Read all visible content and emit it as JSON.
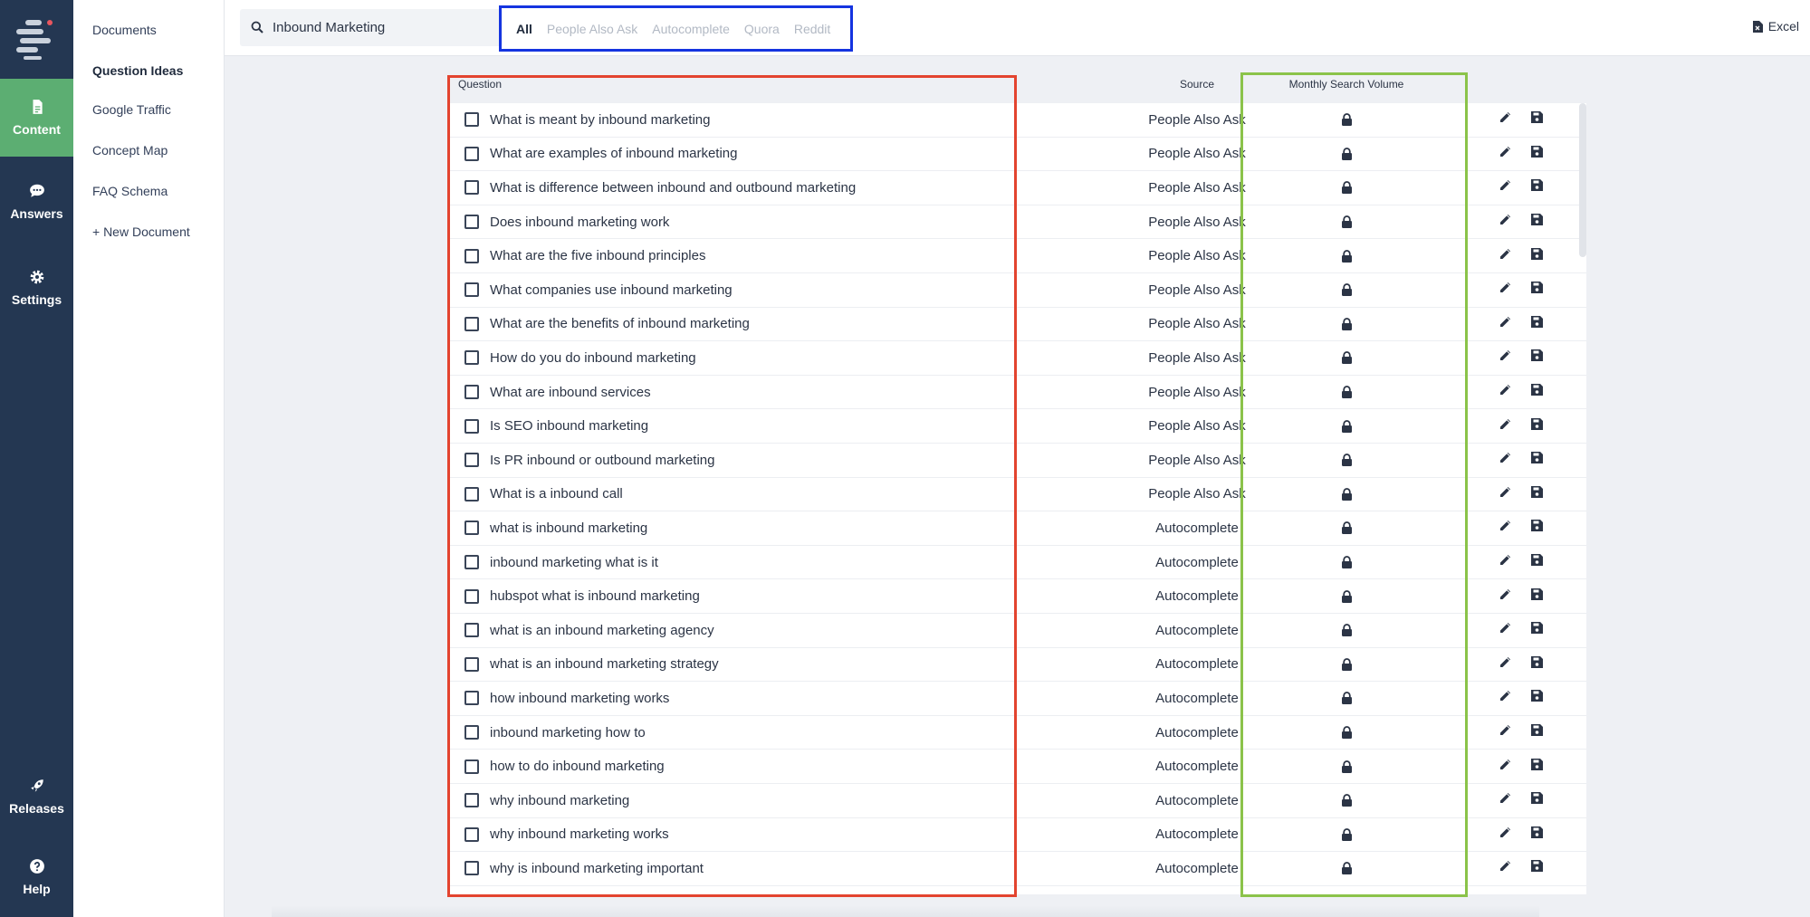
{
  "rail": {
    "items": [
      {
        "label": "Content",
        "icon": "document-icon",
        "active": true
      },
      {
        "label": "Answers",
        "icon": "chat-icon"
      },
      {
        "label": "Settings",
        "icon": "gear-icon"
      },
      {
        "label": "Releases",
        "icon": "rocket-icon"
      },
      {
        "label": "Help",
        "icon": "question-icon"
      }
    ]
  },
  "subnav": {
    "items": [
      "Documents",
      "Question Ideas",
      "Google Traffic",
      "Concept Map",
      "FAQ Schema",
      "+ New Document"
    ],
    "active": "Question Ideas"
  },
  "search": {
    "value": "Inbound Marketing"
  },
  "filters": {
    "tabs": [
      "All",
      "People Also Ask",
      "Autocomplete",
      "Quora",
      "Reddit"
    ],
    "active": "All"
  },
  "export": {
    "label": "Excel"
  },
  "table": {
    "headers": {
      "question": "Question",
      "source": "Source",
      "volume": "Monthly Search Volume"
    },
    "rows": [
      {
        "question": "What is meant by inbound marketing",
        "source": "People Also Ask"
      },
      {
        "question": "What are examples of inbound marketing",
        "source": "People Also Ask"
      },
      {
        "question": "What is difference between inbound and outbound marketing",
        "source": "People Also Ask"
      },
      {
        "question": "Does inbound marketing work",
        "source": "People Also Ask"
      },
      {
        "question": "What are the five inbound principles",
        "source": "People Also Ask"
      },
      {
        "question": "What companies use inbound marketing",
        "source": "People Also Ask"
      },
      {
        "question": "What are the benefits of inbound marketing",
        "source": "People Also Ask"
      },
      {
        "question": "How do you do inbound marketing",
        "source": "People Also Ask"
      },
      {
        "question": "What are inbound services",
        "source": "People Also Ask"
      },
      {
        "question": "Is SEO inbound marketing",
        "source": "People Also Ask"
      },
      {
        "question": "Is PR inbound or outbound marketing",
        "source": "People Also Ask"
      },
      {
        "question": "What is a inbound call",
        "source": "People Also Ask"
      },
      {
        "question": "what is inbound marketing",
        "source": "Autocomplete"
      },
      {
        "question": "inbound marketing what is it",
        "source": "Autocomplete"
      },
      {
        "question": "hubspot what is inbound marketing",
        "source": "Autocomplete"
      },
      {
        "question": "what is an inbound marketing agency",
        "source": "Autocomplete"
      },
      {
        "question": "what is an inbound marketing strategy",
        "source": "Autocomplete"
      },
      {
        "question": "how inbound marketing works",
        "source": "Autocomplete"
      },
      {
        "question": "inbound marketing how to",
        "source": "Autocomplete"
      },
      {
        "question": "how to do inbound marketing",
        "source": "Autocomplete"
      },
      {
        "question": "why inbound marketing",
        "source": "Autocomplete"
      },
      {
        "question": "why inbound marketing works",
        "source": "Autocomplete"
      },
      {
        "question": "why is inbound marketing important",
        "source": "Autocomplete"
      }
    ]
  },
  "colors": {
    "rail": "#243752",
    "active": "#5cae72",
    "filter_box": "#1534e0",
    "question_box": "#e3442f",
    "volume_box": "#8bc34a"
  }
}
